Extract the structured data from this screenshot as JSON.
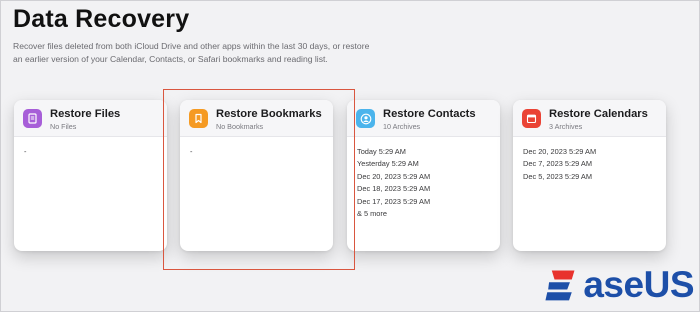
{
  "header": {
    "title": "Data Recovery",
    "description": "Recover files deleted from both iCloud Drive and other apps within the last 30 days, or restore an earlier version of your Calendar, Contacts, or Safari bookmarks and reading list."
  },
  "cards": [
    {
      "title": "Restore Files",
      "subtitle": "No Files",
      "icon": "document-icon",
      "color": "#a75ed8",
      "entries": [
        "-"
      ]
    },
    {
      "title": "Restore Bookmarks",
      "subtitle": "No Bookmarks",
      "icon": "bookmark-icon",
      "color": "#f59a23",
      "entries": [
        "-"
      ]
    },
    {
      "title": "Restore Contacts",
      "subtitle": "10 Archives",
      "icon": "contact-icon",
      "color": "#4bb4ec",
      "entries": [
        "Today 5:29 AM",
        "Yesterday 5:29 AM",
        "Dec 20, 2023 5:29 AM",
        "Dec 18, 2023 5:29 AM",
        "Dec 17, 2023 5:29 AM",
        "& 5 more"
      ]
    },
    {
      "title": "Restore Calendars",
      "subtitle": "3 Archives",
      "icon": "calendar-icon",
      "color": "#ea4335",
      "entries": [
        "Dec 20, 2023 5:29 AM",
        "Dec 7, 2023 5:29 AM",
        "Dec 5, 2023 5:29 AM"
      ]
    }
  ],
  "highlight_color": "#d9563f",
  "brand": {
    "logo_text": "aseUS",
    "logo_color": "#1d4fa8"
  }
}
